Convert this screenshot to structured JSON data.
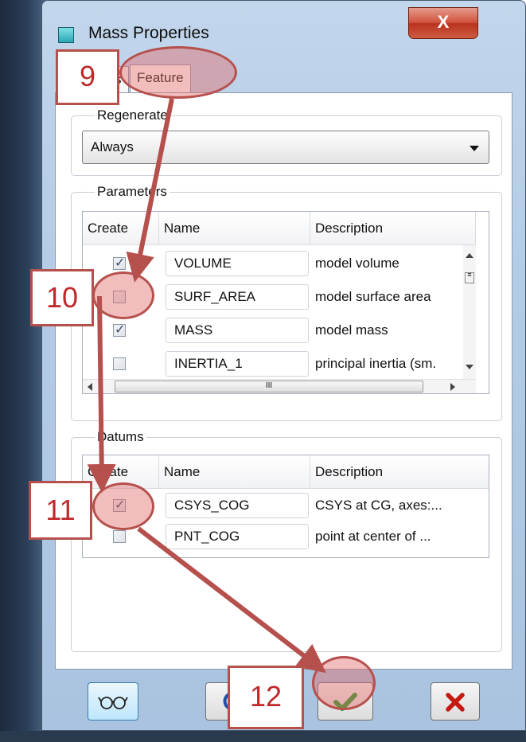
{
  "window": {
    "title": "Mass Properties",
    "close_label": "X"
  },
  "tabs": [
    {
      "label": "s"
    },
    {
      "label": "Feature"
    }
  ],
  "regenerate": {
    "label": "Regenerate",
    "value": "Always"
  },
  "parameters": {
    "label": "Parameters",
    "headers": [
      "Create",
      "Name",
      "Description"
    ],
    "rows": [
      {
        "name": "VOLUME",
        "description": "model volume",
        "checked": true
      },
      {
        "name": "SURF_AREA",
        "description": "model surface area",
        "checked": false
      },
      {
        "name": "MASS",
        "description": "model mass",
        "checked": true
      },
      {
        "name": "INERTIA_1",
        "description": "principal inertia (sm.",
        "checked": false
      }
    ],
    "scroll_thumb": "III"
  },
  "datums": {
    "label": "Datums",
    "headers": [
      "Create",
      "Name",
      "Description"
    ],
    "rows": [
      {
        "name": "CSYS_COG",
        "description": "CSYS at CG, axes:...",
        "checked": true
      },
      {
        "name": "PNT_COG",
        "description": "point at center of ...",
        "checked": false
      }
    ]
  },
  "buttons": {
    "preview": "glasses-icon",
    "repeat": "refresh-icon",
    "ok": "checkmark-icon",
    "cancel": "x-icon"
  },
  "callouts": [
    "9",
    "10",
    "11",
    "12"
  ],
  "colors": {
    "annotation": "#b6504d",
    "callout_text": "#c0282a",
    "ok_green": "#1e9d2a",
    "cancel_red": "#c41a12"
  }
}
